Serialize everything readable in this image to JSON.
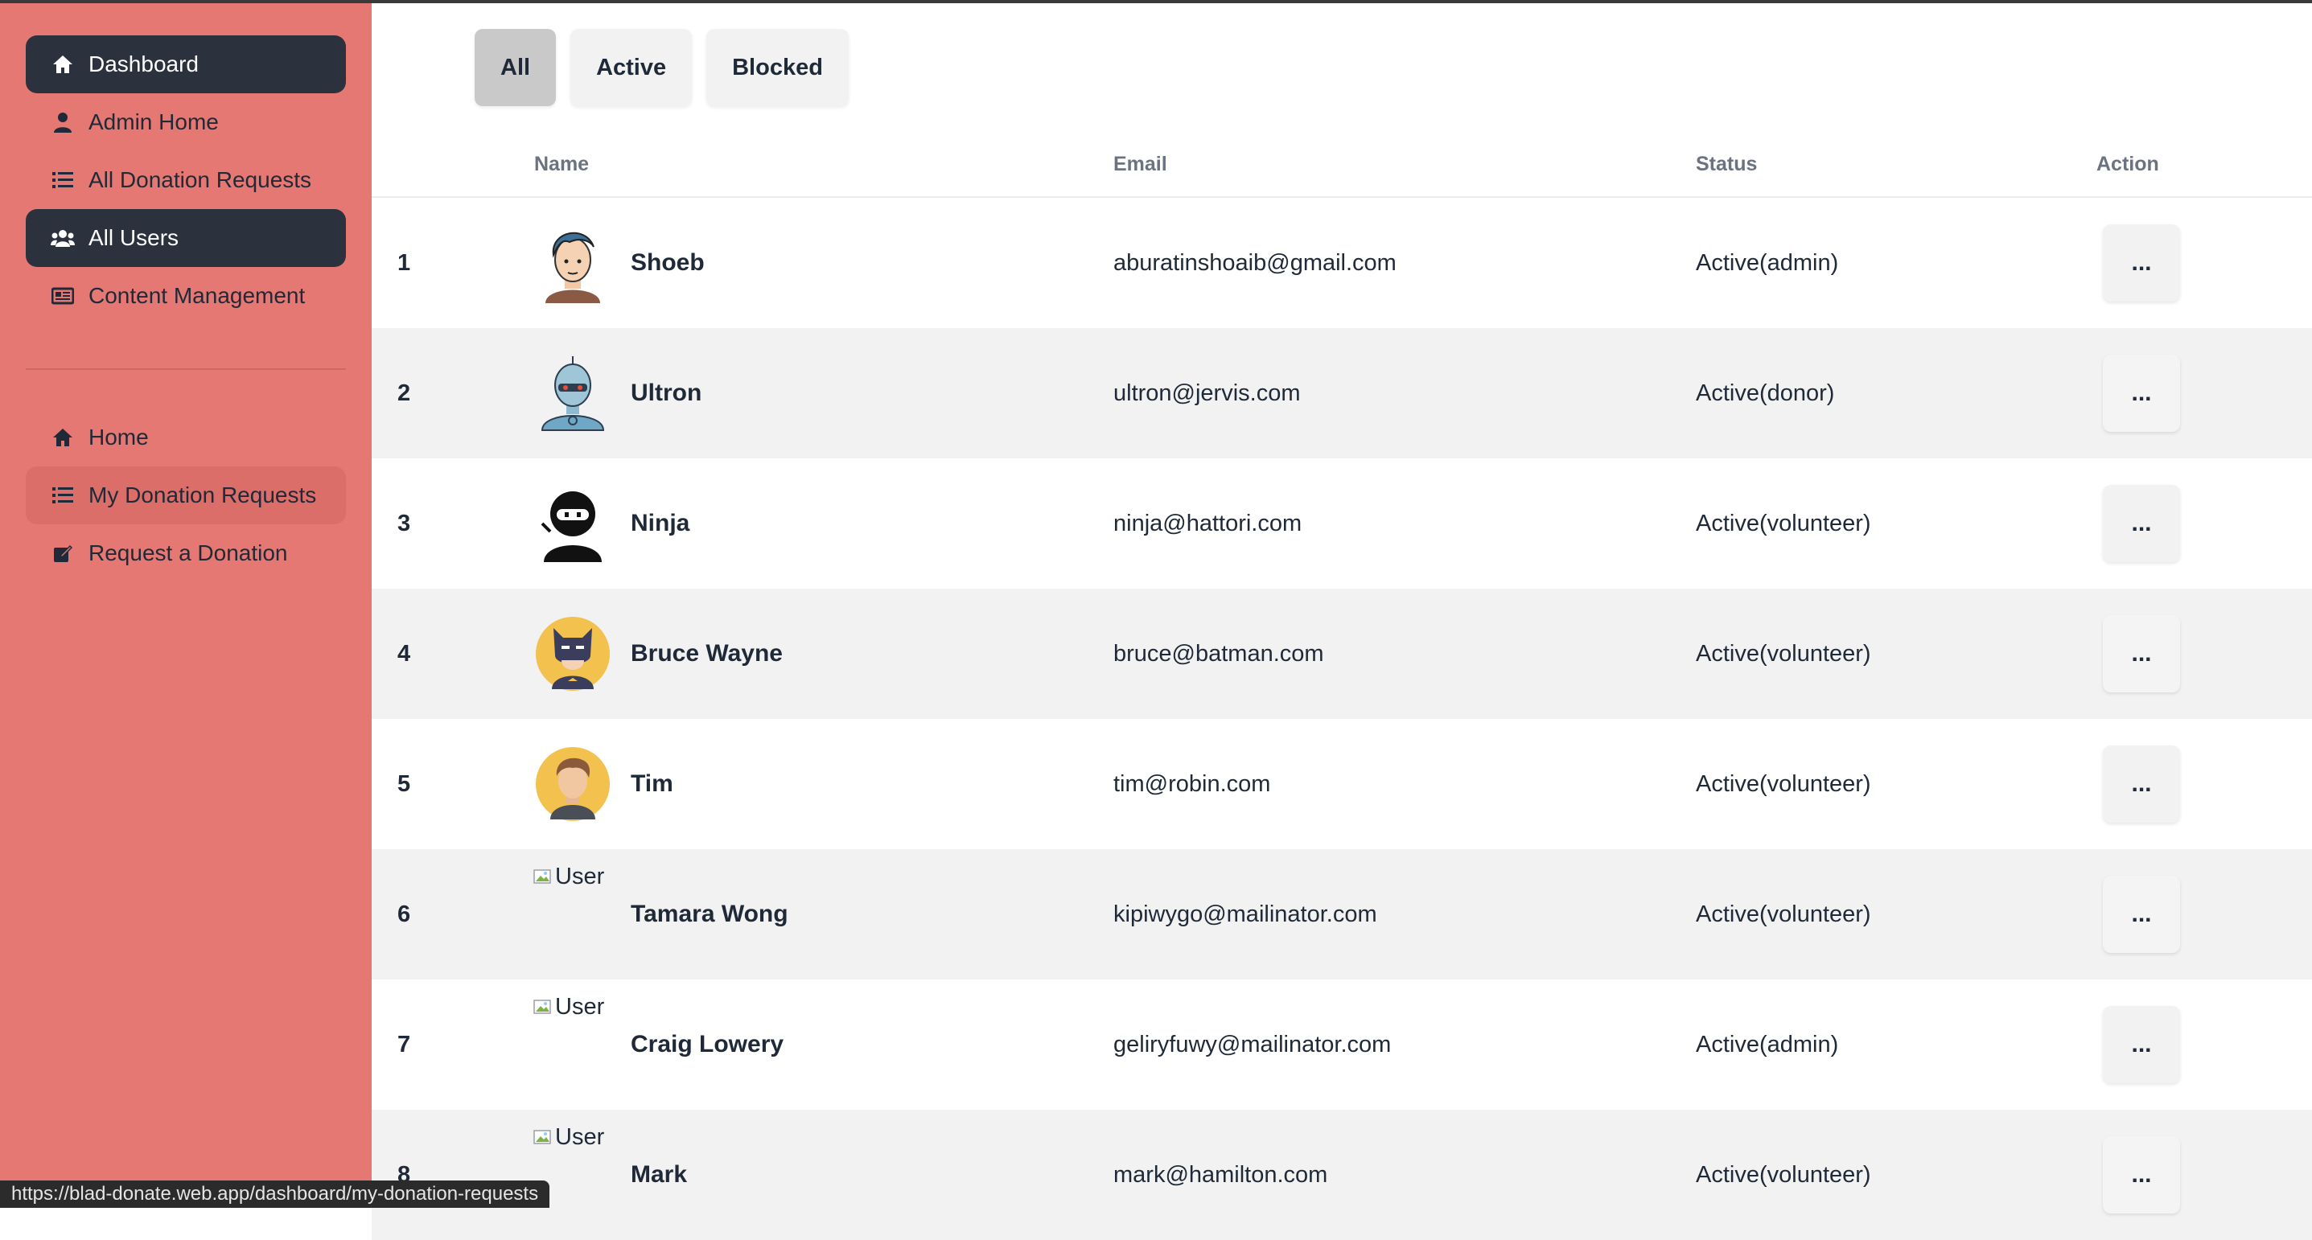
{
  "sidebar": {
    "top_items": [
      {
        "label": "Dashboard",
        "icon": "home-icon",
        "state": "active"
      },
      {
        "label": "Admin Home",
        "icon": "user-icon",
        "state": "normal"
      },
      {
        "label": "All Donation Requests",
        "icon": "list-icon",
        "state": "normal"
      },
      {
        "label": "All Users",
        "icon": "users-icon",
        "state": "active"
      },
      {
        "label": "Content Management",
        "icon": "newspaper-icon",
        "state": "normal"
      }
    ],
    "bottom_items": [
      {
        "label": "Home",
        "icon": "home-icon",
        "state": "normal"
      },
      {
        "label": "My Donation Requests",
        "icon": "list-icon",
        "state": "hover"
      },
      {
        "label": "Request a Donation",
        "icon": "edit-icon",
        "state": "normal"
      }
    ]
  },
  "filters": {
    "tabs": [
      {
        "label": "All",
        "selected": true
      },
      {
        "label": "Active",
        "selected": false
      },
      {
        "label": "Blocked",
        "selected": false
      }
    ]
  },
  "table": {
    "headers": {
      "name": "Name",
      "email": "Email",
      "status": "Status",
      "action": "Action"
    },
    "action_label": "...",
    "broken_avatar_alt": "User",
    "rows": [
      {
        "num": "1",
        "name": "Shoeb",
        "email": "aburatinshoaib@gmail.com",
        "status": "Active(admin)",
        "avatar": "man-avatar"
      },
      {
        "num": "2",
        "name": "Ultron",
        "email": "ultron@jervis.com",
        "status": "Active(donor)",
        "avatar": "robot-avatar"
      },
      {
        "num": "3",
        "name": "Ninja",
        "email": "ninja@hattori.com",
        "status": "Active(volunteer)",
        "avatar": "ninja-avatar"
      },
      {
        "num": "4",
        "name": "Bruce Wayne",
        "email": "bruce@batman.com",
        "status": "Active(volunteer)",
        "avatar": "batman-avatar"
      },
      {
        "num": "5",
        "name": "Tim",
        "email": "tim@robin.com",
        "status": "Active(volunteer)",
        "avatar": "tim-avatar"
      },
      {
        "num": "6",
        "name": "Tamara Wong",
        "email": "kipiwygo@mailinator.com",
        "status": "Active(volunteer)",
        "avatar": "broken"
      },
      {
        "num": "7",
        "name": "Craig Lowery",
        "email": "geliryfuwy@mailinator.com",
        "status": "Active(admin)",
        "avatar": "broken"
      },
      {
        "num": "8",
        "name": "Mark",
        "email": "mark@hamilton.com",
        "status": "Active(volunteer)",
        "avatar": "broken"
      }
    ]
  },
  "status_bar": {
    "url": "https://blad-donate.web.app/dashboard/my-donation-requests"
  }
}
